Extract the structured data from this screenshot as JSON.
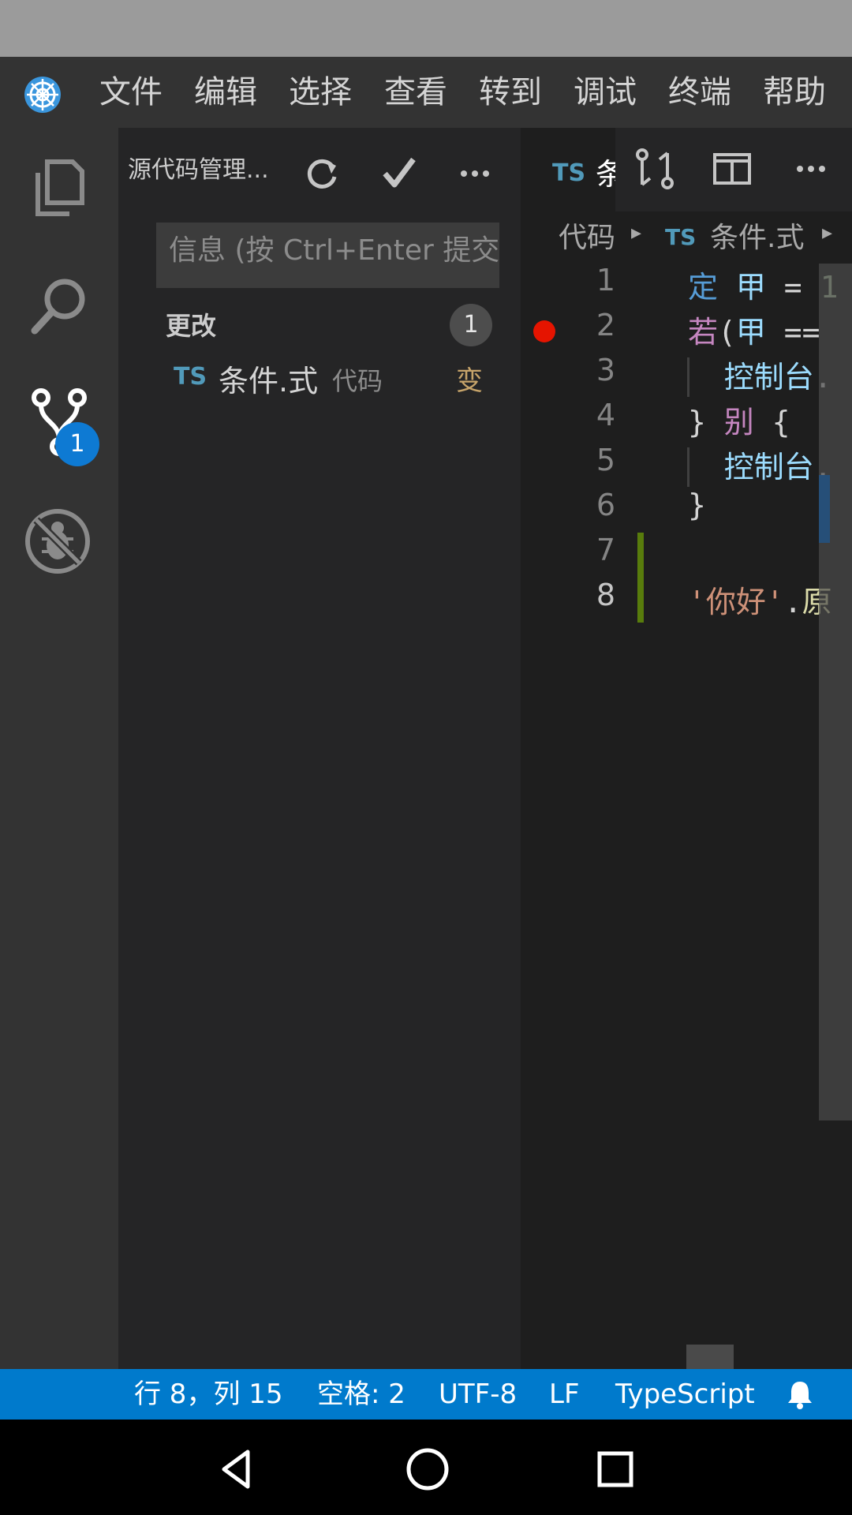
{
  "menu": {
    "items": [
      "文件",
      "编辑",
      "选择",
      "查看",
      "转到",
      "调试",
      "终端",
      "帮助"
    ]
  },
  "activity_bar": {
    "scm_badge": "1",
    "icons": [
      "files-icon",
      "search-icon",
      "source-control-icon",
      "debug-icon"
    ]
  },
  "sidebar": {
    "title": "源代码管理...",
    "message_placeholder": "信息 (按 Ctrl+Enter 提交)",
    "changes_label": "更改",
    "changes_count": "1",
    "file": {
      "lang": "TS",
      "name": "条件.式",
      "dir": "代码",
      "status": "变"
    }
  },
  "editor": {
    "tab": {
      "lang": "TS",
      "name": "条"
    },
    "breadcrumb": {
      "folder": "代码",
      "lang": "TS",
      "file": "条件.式"
    },
    "line_numbers": [
      "1",
      "2",
      "3",
      "4",
      "5",
      "6",
      "7",
      "8"
    ]
  },
  "status_bar": {
    "position": "行 8，列 15",
    "spaces": "空格: 2",
    "encoding": "UTF-8",
    "eol": "LF",
    "language": "TypeScript"
  },
  "colors": {
    "accent": "#007acc",
    "breakpoint": "#e51400",
    "modified_gutter": "#587c0c"
  }
}
